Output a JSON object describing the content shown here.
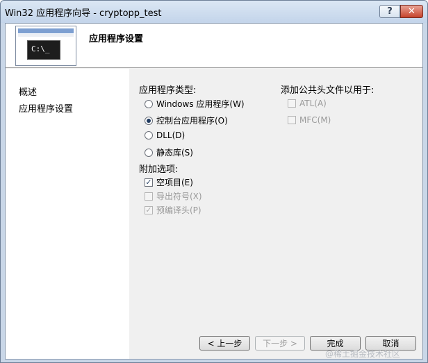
{
  "window": {
    "title": "Win32 应用程序向导 - cryptopp_test",
    "help_glyph": "?",
    "close_glyph": "✕"
  },
  "header": {
    "title": "应用程序设置",
    "icon_text": "C:\\_"
  },
  "nav": {
    "items": [
      {
        "label": "概述"
      },
      {
        "label": "应用程序设置"
      }
    ]
  },
  "app_type": {
    "label": "应用程序类型:",
    "options": [
      {
        "label": "Windows 应用程序(W)",
        "selected": false
      },
      {
        "label": "控制台应用程序(O)",
        "selected": true
      },
      {
        "label": "DLL(D)",
        "selected": false
      },
      {
        "label": "静态库(S)",
        "selected": false
      }
    ]
  },
  "extra_options": {
    "label": "附加选项:",
    "options": [
      {
        "label": "空项目(E)",
        "checked": true,
        "enabled": true
      },
      {
        "label": "导出符号(X)",
        "checked": false,
        "enabled": false
      },
      {
        "label": "预编译头(P)",
        "checked": true,
        "enabled": false
      }
    ]
  },
  "common_headers": {
    "label": "添加公共头文件以用于:",
    "options": [
      {
        "label": "ATL(A)",
        "checked": false,
        "enabled": false
      },
      {
        "label": "MFC(M)",
        "checked": false,
        "enabled": false
      }
    ]
  },
  "buttons": {
    "prev": "< 上一步",
    "next": "下一步 >",
    "finish": "完成",
    "cancel": "取消"
  },
  "watermark": "@稀土掘金技术社区"
}
